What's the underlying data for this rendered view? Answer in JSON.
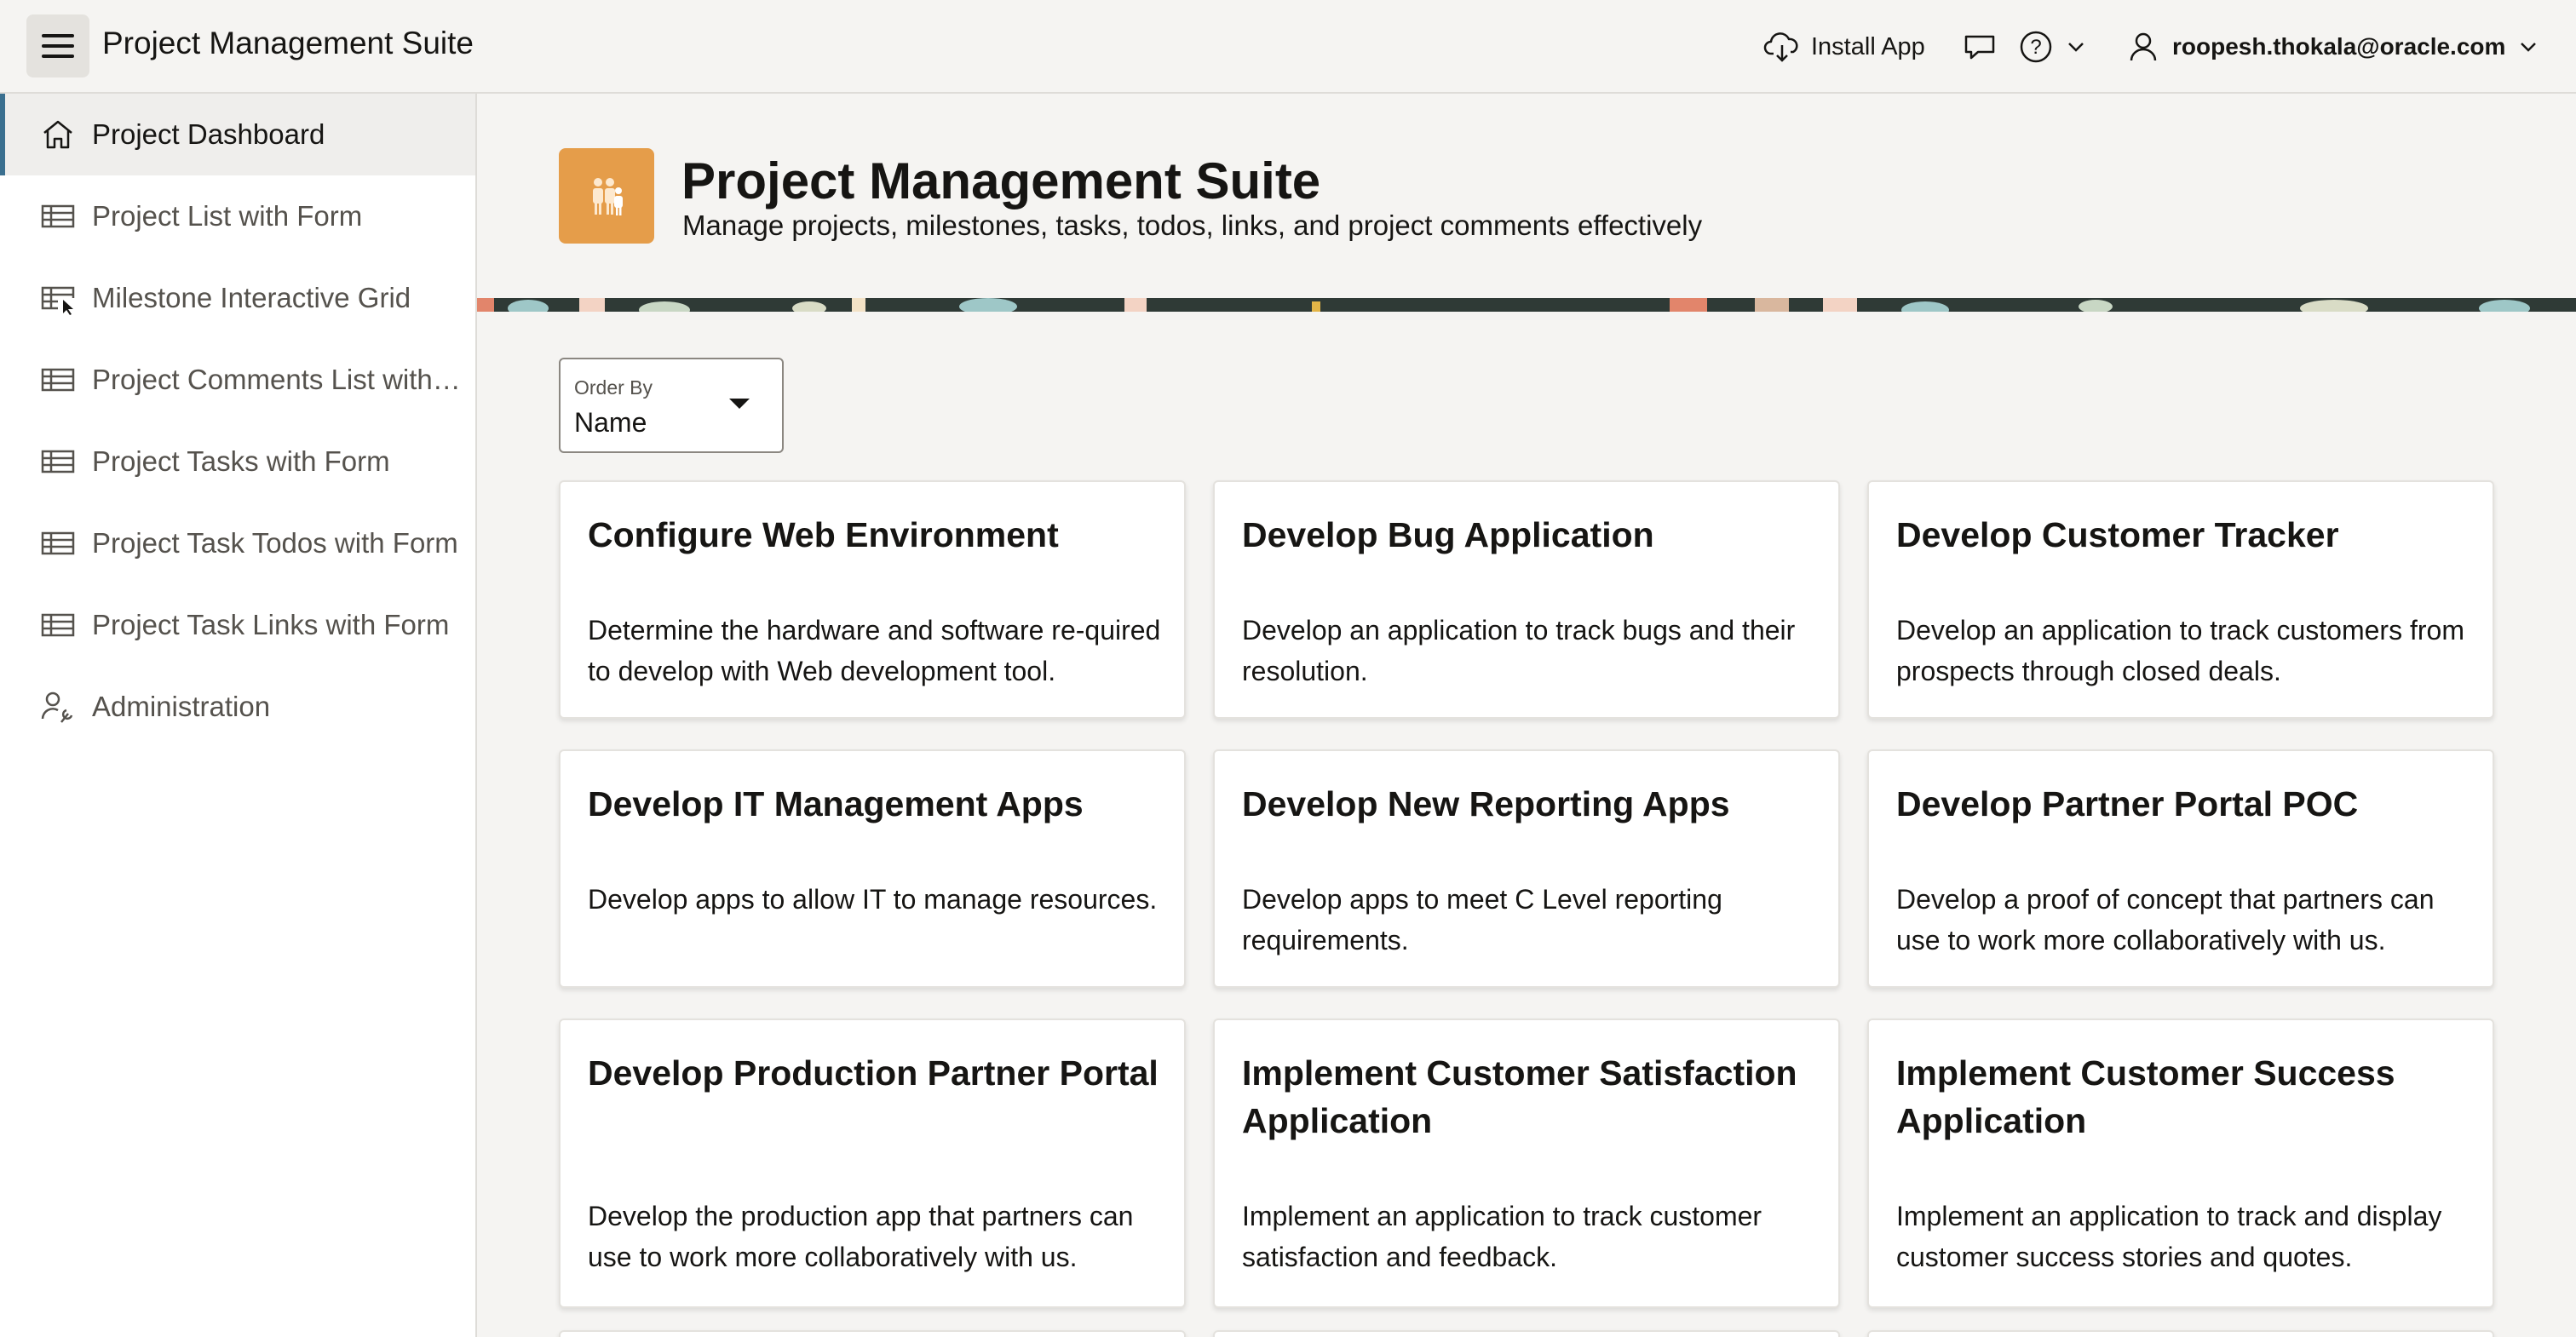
{
  "header": {
    "app_title": "Project Management Suite",
    "install_label": "Install App",
    "user": "roopesh.thokala@oracle.com"
  },
  "sidebar": {
    "items": [
      {
        "label": "Project Dashboard",
        "icon": "home-icon",
        "active": true
      },
      {
        "label": "Project List with Form",
        "icon": "table-icon"
      },
      {
        "label": "Milestone Interactive Grid",
        "icon": "grid-cursor-icon"
      },
      {
        "label": "Project Comments List with Form",
        "icon": "table-icon"
      },
      {
        "label": "Project Tasks with Form",
        "icon": "table-icon"
      },
      {
        "label": "Project Task Todos with Form",
        "icon": "table-icon"
      },
      {
        "label": "Project Task Links with Form",
        "icon": "table-icon"
      },
      {
        "label": "Administration",
        "icon": "wrench-user-icon"
      }
    ]
  },
  "hero": {
    "title": "Project Management Suite",
    "subtitle": "Manage projects, milestones, tasks, todos, links, and project comments effectively",
    "icon": "people-icon",
    "icon_color": "#e59d4a"
  },
  "order_by": {
    "label": "Order By",
    "value": "Name"
  },
  "cards": [
    {
      "title": "Configure Web Environment",
      "description": "Determine the hardware and software re-quired to develop with Web development tool."
    },
    {
      "title": "Develop Bug Application",
      "description": "Develop an application to track bugs and their resolution."
    },
    {
      "title": "Develop Customer Tracker",
      "description": "Develop an application to track customers from prospects through closed deals."
    },
    {
      "title": "Develop IT Management Apps",
      "description": "Develop apps to allow IT to manage resources."
    },
    {
      "title": "Develop New Reporting Apps",
      "description": "Develop apps to meet C Level reporting requirements."
    },
    {
      "title": "Develop Partner Portal POC",
      "description": "Develop a proof of concept that partners can use to work more collaboratively with us."
    },
    {
      "title": "Develop Production Partner Portal",
      "description": "Develop the production app that partners can use to work more collaboratively with us."
    },
    {
      "title": "Implement Customer Satisfaction Application",
      "description": "Implement an application to track customer satisfaction and feedback."
    },
    {
      "title": "Implement Customer Success Application",
      "description": "Implement an application to track and display customer success stories and quotes."
    }
  ],
  "colors": {
    "accent": "#3a6f8f",
    "hero_icon": "#e59d4a",
    "page_bg": "#f5f4f2"
  }
}
